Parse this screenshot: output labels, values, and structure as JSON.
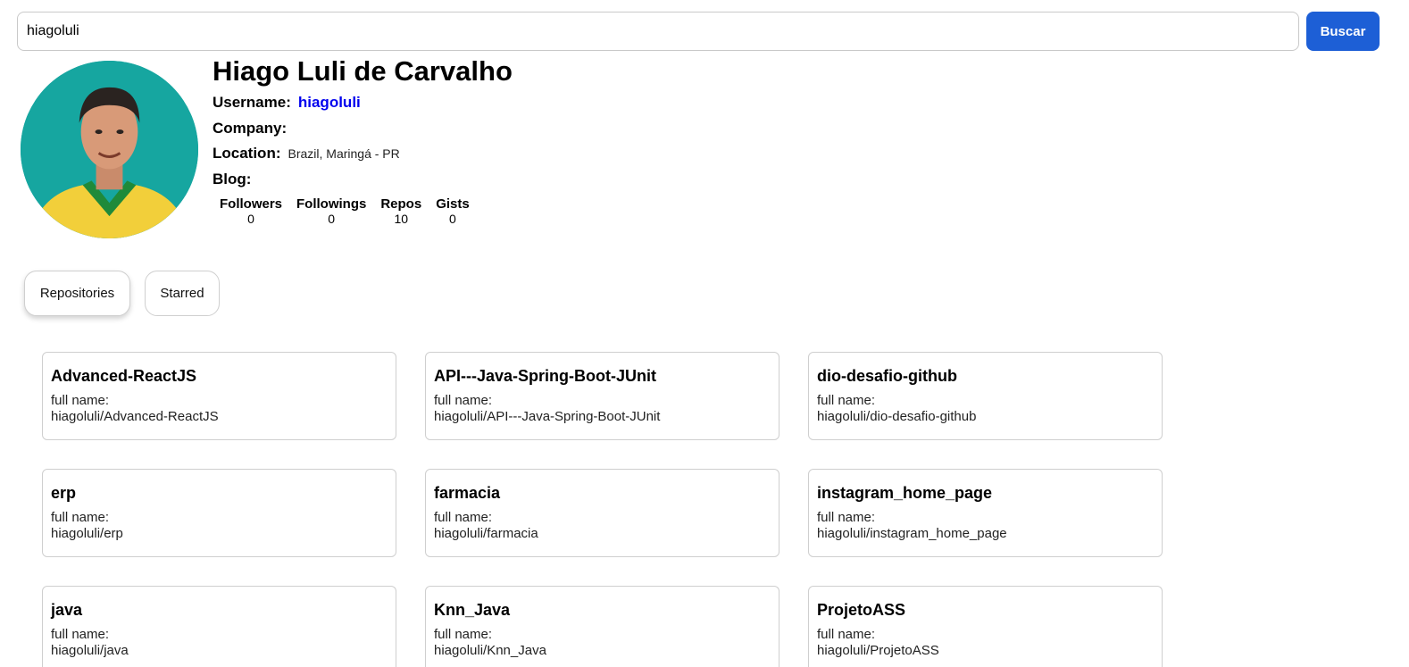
{
  "search": {
    "value": "hiagoluli",
    "button_label": "Buscar"
  },
  "profile": {
    "name": "Hiago Luli de Carvalho",
    "username_label": "Username:",
    "username": "hiagoluli",
    "company_label": "Company:",
    "company": "",
    "location_label": "Location:",
    "location": "Brazil, Maringá - PR",
    "blog_label": "Blog:",
    "blog": "",
    "stats": [
      {
        "label": "Followers",
        "value": "0"
      },
      {
        "label": "Followings",
        "value": "0"
      },
      {
        "label": "Repos",
        "value": "10"
      },
      {
        "label": "Gists",
        "value": "0"
      }
    ]
  },
  "tabs": [
    {
      "label": "Repositories",
      "active": true
    },
    {
      "label": "Starred",
      "active": false
    }
  ],
  "repos": [
    {
      "name": "Advanced-ReactJS",
      "full_name_label": "full name:",
      "full_name": "hiagoluli/Advanced-ReactJS"
    },
    {
      "name": "API---Java-Spring-Boot-JUnit",
      "full_name_label": "full name:",
      "full_name": "hiagoluli/API---Java-Spring-Boot-JUnit"
    },
    {
      "name": "dio-desafio-github",
      "full_name_label": "full name:",
      "full_name": "hiagoluli/dio-desafio-github"
    },
    {
      "name": "erp",
      "full_name_label": "full name:",
      "full_name": "hiagoluli/erp"
    },
    {
      "name": "farmacia",
      "full_name_label": "full name:",
      "full_name": "hiagoluli/farmacia"
    },
    {
      "name": "instagram_home_page",
      "full_name_label": "full name:",
      "full_name": "hiagoluli/instagram_home_page"
    },
    {
      "name": "java",
      "full_name_label": "full name:",
      "full_name": "hiagoluli/java"
    },
    {
      "name": "Knn_Java",
      "full_name_label": "full name:",
      "full_name": "hiagoluli/Knn_Java"
    },
    {
      "name": "ProjetoASS",
      "full_name_label": "full name:",
      "full_name": "hiagoluli/ProjetoASS"
    }
  ],
  "colors": {
    "accent": "#1d5fd6",
    "link": "#0000ee",
    "avatar_bg": "#16a6a0"
  }
}
